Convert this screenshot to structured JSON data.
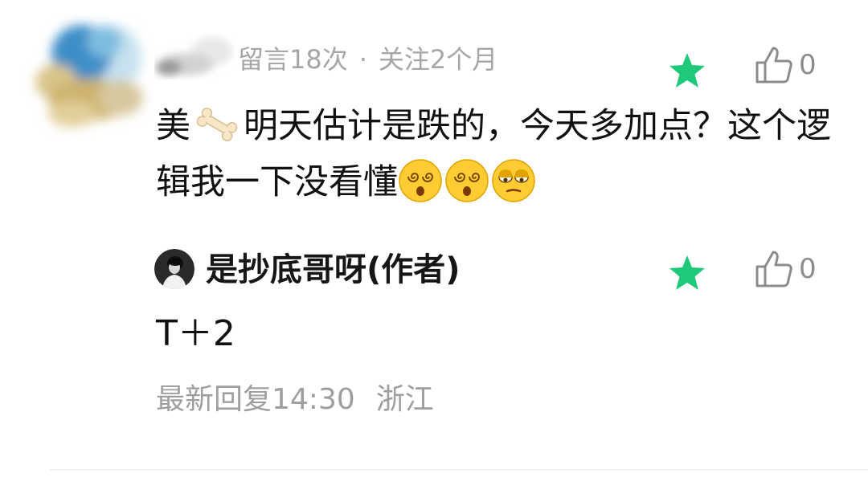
{
  "comment": {
    "meta_messages": "留言18次",
    "meta_separator": "·",
    "meta_follow": "关注2个月",
    "text_part1": "美",
    "bone_emoji_icon": "bone-emoji",
    "text_part2": "明天估计是跌的，今天多加点？这个逻辑我一下没看懂",
    "emojis": [
      "dizzy-face-emoji",
      "dizzy-face-emoji",
      "unamused-face-emoji"
    ],
    "like_count": "0"
  },
  "reply": {
    "author": "是抄底哥呀(作者)",
    "text": "T＋2",
    "latest_reply_label": "最新回复14:30",
    "location": "浙江",
    "like_count": "0"
  },
  "colors": {
    "star": "#1ec97a",
    "meta_text": "#a6a6a6",
    "body_text": "#111111"
  }
}
